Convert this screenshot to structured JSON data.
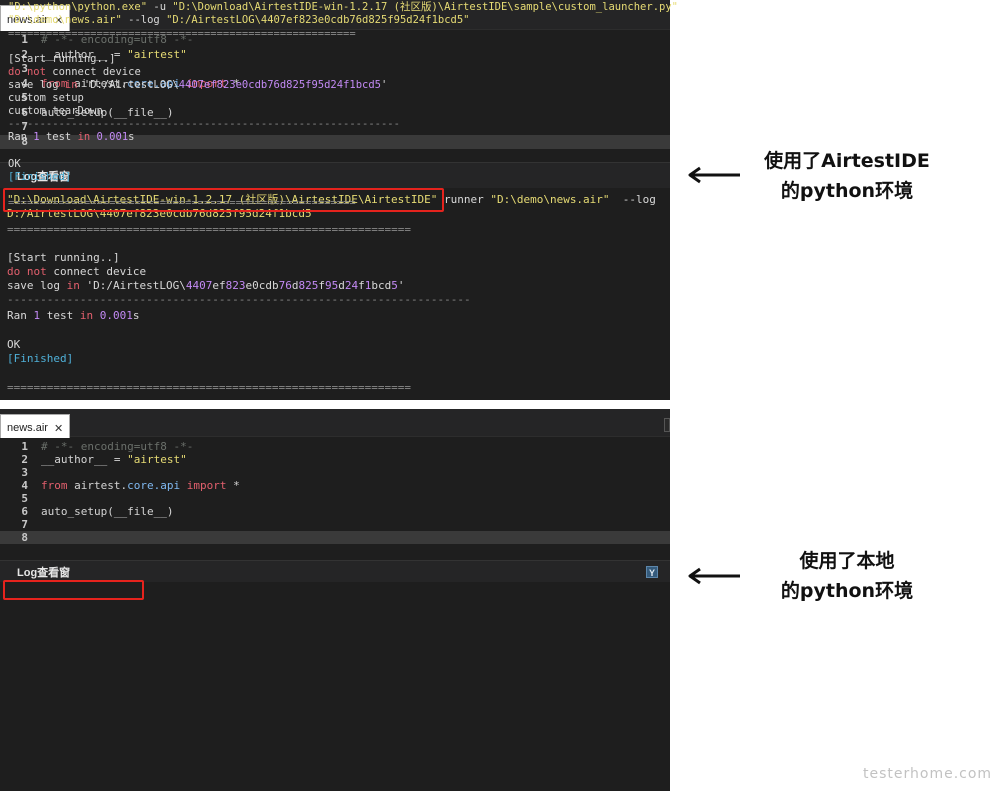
{
  "top_panel": {
    "tab": {
      "label": "news.air",
      "close": "✕"
    },
    "code_lines": [
      {
        "num": "1",
        "text": "# -*- encoding=utf8 -*-"
      },
      {
        "num": "2",
        "a": "__author__ = ",
        "b": "\"airtest\""
      },
      {
        "num": "3",
        "text": ""
      },
      {
        "num": "4",
        "kw1": "from",
        "a": " airtest.",
        "mod": "core.api",
        "sp": " ",
        "kw2": "import",
        "b": " *"
      },
      {
        "num": "5",
        "text": ""
      },
      {
        "num": "6",
        "text": "auto_setup(__file__)"
      },
      {
        "num": "7",
        "text": ""
      },
      {
        "num": "8",
        "text": ""
      }
    ],
    "log_title": "Log查看窗",
    "log": {
      "cmd_path": "\"D:\\Download\\AirtestIDE-win-1.2.17 (社区版)\\AirtestIDE\\AirtestIDE\"",
      "cmd_rest_a": " runner ",
      "cmd_rest_b": "\"D:\\demo\\news.air\"",
      "cmd_rest_c": "  --log",
      "cmd_line2": "D:/AirtestLOG\\4407ef823e0cdb76d825f95d24f1bcd5",
      "sep_long": "=============================================================",
      "start": "[Start running..]",
      "do": "do",
      "not": "not",
      "connect": " connect device",
      "save_a": "save log ",
      "save_in": "in",
      "save_b": " 'D:/AirtestLOG\\",
      "save_hash_a": "4407",
      "save_hash_b": "ef",
      "save_hash_c": "823",
      "save_hash_d": "e0cdb",
      "save_hash_e": "76",
      "save_hash_f": "d",
      "save_hash_g": "825",
      "save_hash_h": "f",
      "save_hash_i": "95",
      "save_hash_j": "d",
      "save_hash_k": "24",
      "save_hash_l": "f",
      "save_hash_m": "1",
      "save_hash_n": "bcd",
      "save_hash_o": "5",
      "save_end": "'",
      "dash": "----------------------------------------------------------------------",
      "ran_a": "Ran ",
      "ran_1": "1",
      "ran_b": " test ",
      "ran_in": "in",
      "ran_time": " 0.001",
      "ran_s": "s",
      "ok": "OK",
      "finished": "[Finished]",
      "sep_end": "============================================================="
    },
    "annotation": [
      "使用了AirtestIDE",
      "的python环境"
    ]
  },
  "bottom_panel": {
    "tab": {
      "label": "news.air",
      "close": "✕"
    },
    "code_lines": [
      {
        "num": "1",
        "text": "# -*- encoding=utf8 -*-"
      },
      {
        "num": "2",
        "a": "__author__ = ",
        "b": "\"airtest\""
      },
      {
        "num": "3",
        "text": ""
      },
      {
        "num": "4",
        "kw1": "from",
        "a": " airtest.",
        "mod": "core.api",
        "sp": " ",
        "kw2": "import",
        "b": " *"
      },
      {
        "num": "5",
        "text": ""
      },
      {
        "num": "6",
        "text": "auto_setup(__file__)"
      },
      {
        "num": "7",
        "text": ""
      },
      {
        "num": "8",
        "text": ""
      }
    ],
    "log_title": "Log查看窗",
    "filter_icon": "Y",
    "log": {
      "cmd_path": "\"D:\\python\\python.exe\"",
      "cmd_rest_a": " -u ",
      "cmd_rest_b": "\"D:\\Download\\AirtestIDE-win-1.2.17 (社区版)\\AirtestIDE\\sample\\custom_launcher.py\"",
      "cmd_line2_a": "\"D:\\demo\\news.air\"",
      "cmd_line2_b": " --log ",
      "cmd_line2_c": "\"D:/AirtestLOG\\4407ef823e0cdb76d825f95d24f1bcd5\"",
      "sep_long": "=======================================================",
      "start": "[Start running..]",
      "do": "do",
      "not": "not",
      "connect": " connect device",
      "save_a": "save log ",
      "save_in": "in",
      "save_b": " 'D:/AirtestLOG\\",
      "save_hash": "4407ef823e0cdb76d825f95d24f1bcd5",
      "save_end": "'",
      "setup": "custom setup",
      "teardown": "custom tearDown",
      "dash": "--------------------------------------------------------------",
      "ran_a": "Ran ",
      "ran_1": "1",
      "ran_b": " test ",
      "ran_in": "in",
      "ran_time": " 0.001",
      "ran_s": "s",
      "ok": "OK",
      "finished": "[Finished]",
      "sep_end": "======================================================="
    },
    "annotation": [
      "使用了本地",
      "的python环境"
    ]
  },
  "watermark": "testerhome.com",
  "colors": {
    "highlight": "#e5231d",
    "background": "#1e1e1e"
  }
}
